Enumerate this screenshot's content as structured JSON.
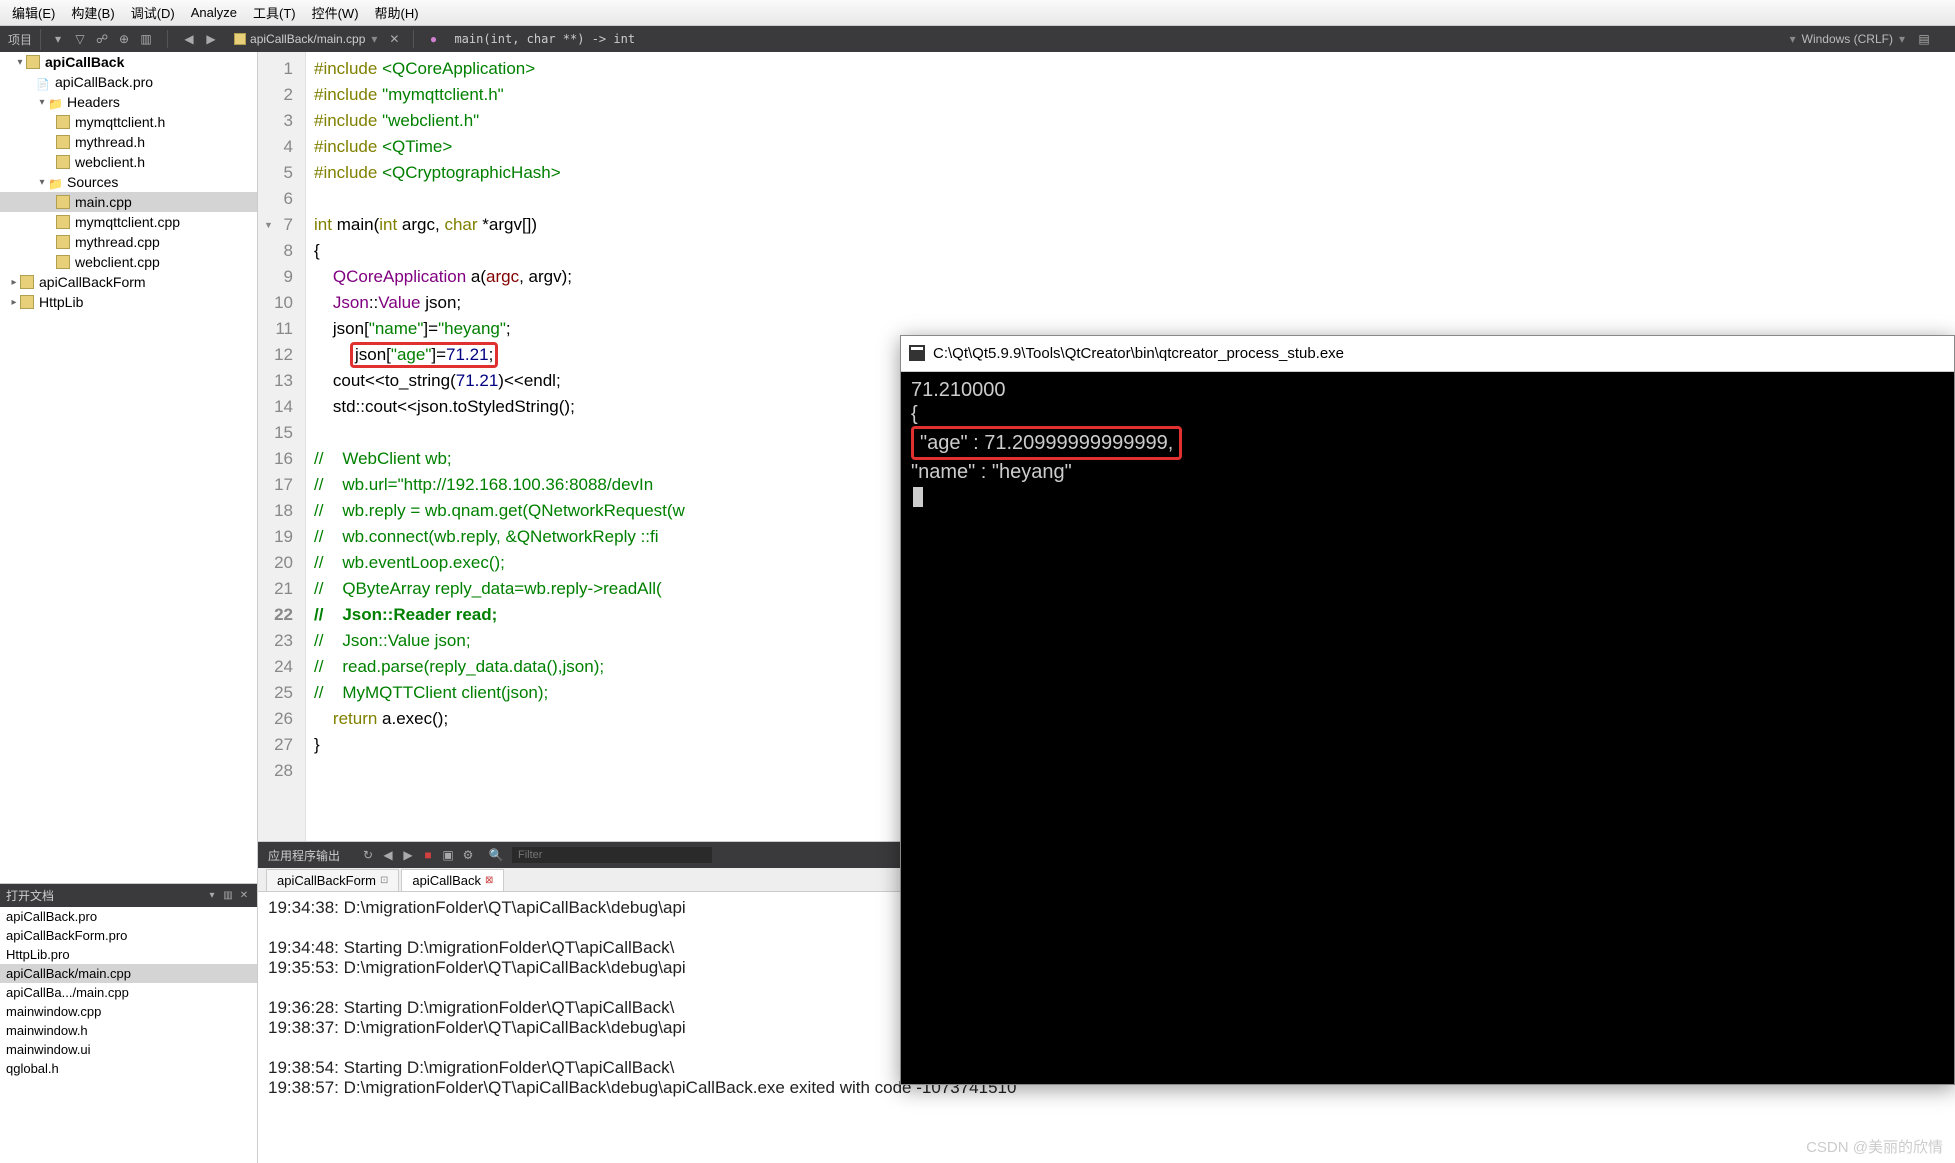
{
  "menu": {
    "items": [
      "编辑(E)",
      "构建(B)",
      "调试(D)",
      "Analyze",
      "工具(T)",
      "控件(W)",
      "帮助(H)"
    ]
  },
  "toolbar": {
    "projectLabel": "项目",
    "filePath": "apiCallBack/main.cpp",
    "funcSig": "main(int, char **) -> int",
    "encoding": "Windows (CRLF)"
  },
  "tree": {
    "root": "apiCallBack",
    "pro": "apiCallBack.pro",
    "headers": "Headers",
    "headerFiles": [
      "mymqttclient.h",
      "mythread.h",
      "webclient.h"
    ],
    "sources": "Sources",
    "sourceFiles": [
      "main.cpp",
      "mymqttclient.cpp",
      "mythread.cpp",
      "webclient.cpp"
    ],
    "siblings": [
      "apiCallBackForm",
      "HttpLib"
    ]
  },
  "openDocs": {
    "title": "打开文档",
    "files": [
      "apiCallBack.pro",
      "apiCallBackForm.pro",
      "HttpLib.pro",
      "apiCallBack/main.cpp",
      "apiCallBa.../main.cpp",
      "mainwindow.cpp",
      "mainwindow.h",
      "mainwindow.ui",
      "qglobal.h"
    ],
    "selectedIndex": 3
  },
  "code": {
    "lines": [
      {
        "n": 1,
        "html": "<span class='kw'>#include</span> <span class='str'>&lt;QCoreApplication&gt;</span>"
      },
      {
        "n": 2,
        "html": "<span class='kw'>#include</span> <span class='str'>\"mymqttclient.h\"</span>"
      },
      {
        "n": 3,
        "html": "<span class='kw'>#include</span> <span class='str'>\"webclient.h\"</span>"
      },
      {
        "n": 4,
        "html": "<span class='kw'>#include</span> <span class='str'>&lt;QTime&gt;</span>"
      },
      {
        "n": 5,
        "html": "<span class='kw'>#include</span> <span class='str'>&lt;QCryptographicHash&gt;</span>"
      },
      {
        "n": 6,
        "html": ""
      },
      {
        "n": 7,
        "tri": true,
        "html": "<span class='kw'>int</span> <span class='fn'>main</span>(<span class='kw'>int</span> argc, <span class='kw'>char</span> *argv[])"
      },
      {
        "n": 8,
        "html": "{"
      },
      {
        "n": 9,
        "html": "    <span class='ty'>QCoreApplication</span> <span class='fn'>a</span>(<span class='var'>argc</span>, argv);"
      },
      {
        "n": 10,
        "html": "    <span class='ty'>Json</span>::<span class='ty'>Value</span> json;"
      },
      {
        "n": 11,
        "html": "    json[<span class='str'>\"name\"</span>]=<span class='str'>\"heyang\"</span>;"
      },
      {
        "n": 12,
        "hl": true,
        "html": "    json[<span class='str'>\"age\"</span>]=<span class='num'>71.21</span>;"
      },
      {
        "n": 13,
        "html": "    cout&lt;&lt;to_string(<span class='num'>71.21</span>)&lt;&lt;endl;"
      },
      {
        "n": 14,
        "html": "    std::cout&lt;&lt;json.toStyledString();"
      },
      {
        "n": 15,
        "html": ""
      },
      {
        "n": 16,
        "html": "<span class='cm'>//    WebClient wb;</span>"
      },
      {
        "n": 17,
        "html": "<span class='cm'>//    wb.url=\"http://192.168.100.36:8088/devIn</span>"
      },
      {
        "n": 18,
        "html": "<span class='cm'>//    wb.reply = wb.qnam.get(QNetworkRequest(w</span>"
      },
      {
        "n": 19,
        "html": "<span class='cm'>//    wb.connect(wb.reply, &amp;QNetworkReply ::fi</span>"
      },
      {
        "n": 20,
        "html": "<span class='cm'>//    wb.eventLoop.exec();</span>"
      },
      {
        "n": 21,
        "html": "<span class='cm'>//    QByteArray reply_data=wb.reply-&gt;readAll(</span>"
      },
      {
        "n": 22,
        "bold": true,
        "html": "<span class='cm'>//    Json::Reader read;</span>"
      },
      {
        "n": 23,
        "html": "<span class='cm'>//    Json::Value json;</span>"
      },
      {
        "n": 24,
        "html": "<span class='cm'>//    read.parse(reply_data.data(),json);</span>"
      },
      {
        "n": 25,
        "html": "<span class='cm'>//    MyMQTTClient client(json);</span>"
      },
      {
        "n": 26,
        "html": "    <span class='kw'>return</span> a.exec();"
      },
      {
        "n": 27,
        "html": "}"
      },
      {
        "n": 28,
        "html": ""
      }
    ]
  },
  "output": {
    "title": "应用程序输出",
    "filterPlaceholder": "Filter",
    "tabs": [
      {
        "label": "apiCallBackForm",
        "active": false
      },
      {
        "label": "apiCallBack",
        "active": true
      }
    ],
    "lines": [
      "19:34:38: D:\\migrationFolder\\QT\\apiCallBack\\debug\\api",
      "",
      "19:34:48: Starting D:\\migrationFolder\\QT\\apiCallBack\\",
      "19:35:53: D:\\migrationFolder\\QT\\apiCallBack\\debug\\api",
      "",
      "19:36:28: Starting D:\\migrationFolder\\QT\\apiCallBack\\",
      "19:38:37: D:\\migrationFolder\\QT\\apiCallBack\\debug\\api",
      "",
      "19:38:54: Starting D:\\migrationFolder\\QT\\apiCallBack\\",
      "19:38:57: D:\\migrationFolder\\QT\\apiCallBack\\debug\\apiCallBack.exe exited with code -1073741510"
    ]
  },
  "console": {
    "title": "C:\\Qt\\Qt5.9.9\\Tools\\QtCreator\\bin\\qtcreator_process_stub.exe",
    "lines": [
      "71.210000",
      "{",
      "HL:   \"age\" : 71.20999999999999,",
      "   \"name\" : \"heyang\""
    ]
  },
  "watermark": "CSDN @美丽的欣情"
}
